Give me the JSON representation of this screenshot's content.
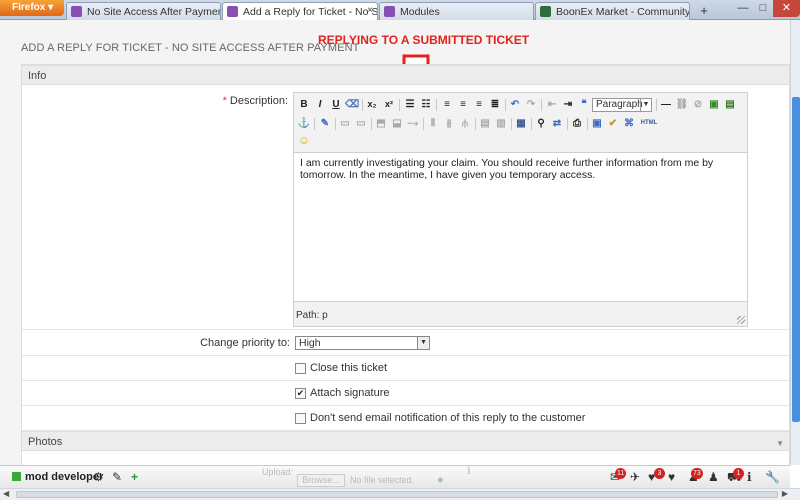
{
  "browser": {
    "menu_button": "Firefox",
    "menu_arrow": "▾",
    "new_tab_symbol": "+",
    "tabs": [
      {
        "label": "No Site Access After Payment",
        "favicon_color": "#8a4fb5"
      },
      {
        "label": "Add a Reply for Ticket - No Site ...",
        "favicon_color": "#8a4fb5"
      },
      {
        "label": "Modules",
        "favicon_color": "#8a4fb5"
      },
      {
        "label": "BoonEx Market - Community Sof...",
        "favicon_color": "#2f6d3c"
      }
    ],
    "tab_close": "×",
    "window": {
      "minimize": "—",
      "maximize": "□",
      "close": "✕"
    }
  },
  "page": {
    "title": "ADD A REPLY FOR TICKET - NO SITE ACCESS AFTER PAYMENT",
    "annotation": "REPLYING TO A SUBMITTED TICKET",
    "annotation_color": "#e0241d"
  },
  "form": {
    "section_info": "Info",
    "description_required": "*",
    "description_label": "Description:",
    "editor": {
      "format_value": "Paragraph",
      "content": "I am currently investigating your claim. You should receive further information from me by tomorrow. In the meantime, I have given you temporary access.",
      "path": "Path: p",
      "toolbar_row1": {
        "bold": "B",
        "italic": "I",
        "underline": "U",
        "subscript": "x₂",
        "superscript": "x²",
        "html_label": "HTML"
      }
    },
    "priority_label": "Change priority to:",
    "priority_value": "High",
    "close_ticket_label": "Close this ticket",
    "close_ticket_checked": false,
    "attach_signature_label": "Attach signature",
    "attach_signature_checked": true,
    "no_email_label": "Don't send email notification of this reply to the customer",
    "no_email_checked": false,
    "section_photos": "Photos",
    "upload_label": "Upload:",
    "browse_button": "Browse...",
    "no_file": "No file selected."
  },
  "bottombar": {
    "user_name": "mod developer",
    "status_color": "#3aa83a",
    "badges": {
      "mail": "11",
      "hearts": "3",
      "friends": "73",
      "cart": "1"
    }
  }
}
